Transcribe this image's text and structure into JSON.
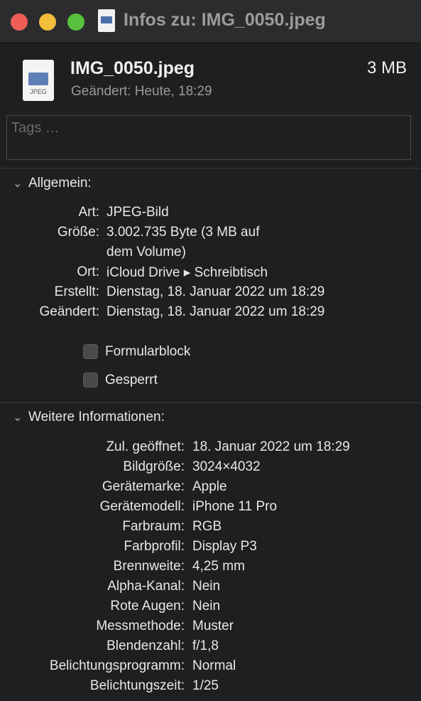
{
  "window": {
    "title": "Infos zu: IMG_0050.jpeg"
  },
  "file": {
    "name": "IMG_0050.jpeg",
    "size": "3 MB",
    "modified": "Geändert: Heute, 18:29",
    "icon_label": "JPEG"
  },
  "tags": {
    "placeholder": "Tags …"
  },
  "general": {
    "title": "Allgemein:",
    "rows": [
      {
        "key": "Art:",
        "value": "JPEG-Bild"
      },
      {
        "key": "Größe:",
        "value": "3.002.735 Byte (3 MB auf",
        "value2": "dem Volume)"
      },
      {
        "key": "Ort:",
        "value": "iCloud Drive ▸ Schreibtisch"
      },
      {
        "key": "Erstellt:",
        "value": "Dienstag, 18. Januar 2022 um 18:29"
      },
      {
        "key": "Geändert:",
        "value": "Dienstag, 18. Januar 2022 um 18:29"
      }
    ],
    "checkboxes": [
      {
        "label": "Formularblock",
        "checked": false
      },
      {
        "label": "Gesperrt",
        "checked": false
      }
    ]
  },
  "more": {
    "title": "Weitere Informationen:",
    "rows": [
      {
        "key": "Zul. geöffnet:",
        "value": "18. Januar 2022 um 18:29"
      },
      {
        "key": "Bildgröße:",
        "value": "3024×4032"
      },
      {
        "key": "Gerätemarke:",
        "value": "Apple"
      },
      {
        "key": "Gerätemodell:",
        "value": "iPhone 11 Pro"
      },
      {
        "key": "Farbraum:",
        "value": "RGB"
      },
      {
        "key": "Farbprofil:",
        "value": "Display P3"
      },
      {
        "key": "Brennweite:",
        "value": "4,25 mm"
      },
      {
        "key": "Alpha-Kanal:",
        "value": "Nein"
      },
      {
        "key": "Rote Augen:",
        "value": "Nein"
      },
      {
        "key": "Messmethode:",
        "value": "Muster"
      },
      {
        "key": "Blendenzahl:",
        "value": "f/1,8"
      },
      {
        "key": "Belichtungsprogramm:",
        "value": "Normal"
      },
      {
        "key": "Belichtungszeit:",
        "value": "1/25"
      }
    ]
  }
}
